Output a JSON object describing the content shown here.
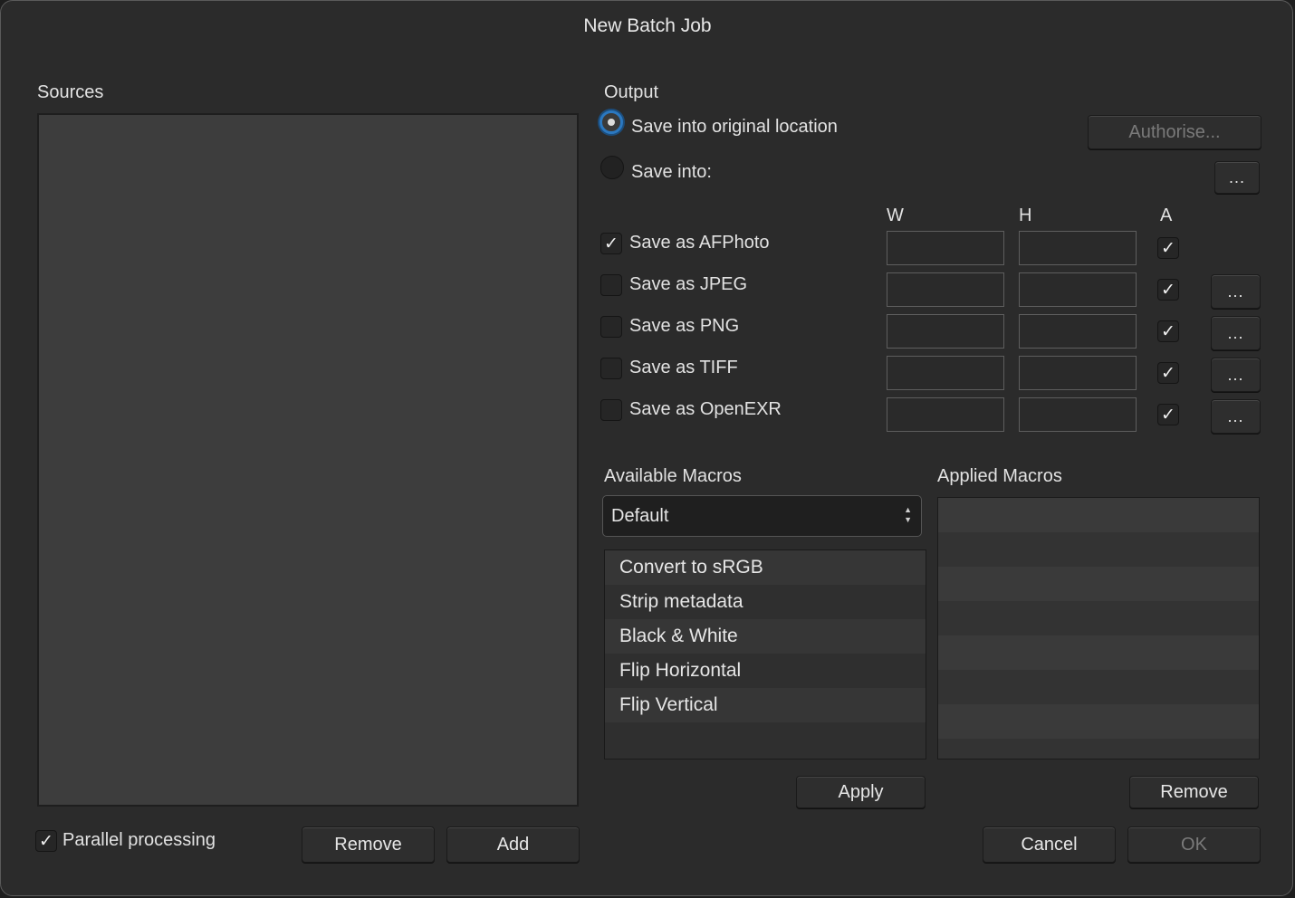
{
  "dialog": {
    "title": "New Batch Job"
  },
  "sources": {
    "label": "Sources",
    "parallel_processing": {
      "label": "Parallel processing",
      "checked": true
    },
    "remove_label": "Remove",
    "add_label": "Add"
  },
  "output": {
    "label": "Output",
    "save_original": {
      "label": "Save into original location",
      "selected": true
    },
    "save_into": {
      "label": "Save into:",
      "selected": false
    },
    "authorise_label": "Authorise...",
    "browse_label": "...",
    "columns": {
      "w": "W",
      "h": "H",
      "a": "A"
    },
    "formats": [
      {
        "label": "Save as AFPhoto",
        "checked": true,
        "w": "",
        "h": "",
        "a": true,
        "has_options": false
      },
      {
        "label": "Save as JPEG",
        "checked": false,
        "w": "",
        "h": "",
        "a": true,
        "has_options": true,
        "options_label": "..."
      },
      {
        "label": "Save as PNG",
        "checked": false,
        "w": "",
        "h": "",
        "a": true,
        "has_options": true,
        "options_label": "..."
      },
      {
        "label": "Save as TIFF",
        "checked": false,
        "w": "",
        "h": "",
        "a": true,
        "has_options": true,
        "options_label": "..."
      },
      {
        "label": "Save as OpenEXR",
        "checked": false,
        "w": "",
        "h": "",
        "a": true,
        "has_options": true,
        "options_label": "..."
      }
    ]
  },
  "macros": {
    "available_label": "Available Macros",
    "category_selected": "Default",
    "available_items": [
      "Convert to sRGB",
      "Strip metadata",
      "Black & White",
      "Flip Horizontal",
      "Flip Vertical"
    ],
    "applied_label": "Applied Macros",
    "applied_items": [],
    "apply_label": "Apply",
    "remove_label": "Remove"
  },
  "footer": {
    "cancel_label": "Cancel",
    "ok_label": "OK"
  }
}
